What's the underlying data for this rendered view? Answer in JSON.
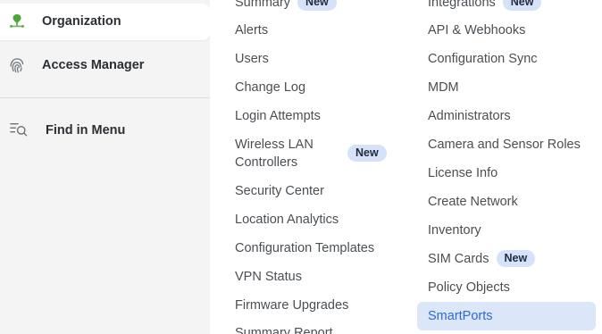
{
  "sidebar": {
    "organization_label": "Organization",
    "access_manager_label": "Access Manager",
    "find_in_menu_label": "Find in Menu"
  },
  "menu": {
    "new_badge": "New",
    "left": [
      {
        "label": "Summary",
        "badge": "New"
      },
      {
        "label": "Alerts"
      },
      {
        "label": "Users"
      },
      {
        "label": "Change Log"
      },
      {
        "label": "Login Attempts"
      },
      {
        "label_line1": "Wireless LAN",
        "label_line2": "Controllers",
        "badge": "New"
      },
      {
        "label": "Security Center"
      },
      {
        "label": "Location Analytics"
      },
      {
        "label": "Configuration Templates"
      },
      {
        "label": "VPN Status"
      },
      {
        "label": "Firmware Upgrades"
      },
      {
        "label": "Summary Report"
      }
    ],
    "right": [
      {
        "label": "Integrations",
        "badge": "New"
      },
      {
        "label": "API & Webhooks"
      },
      {
        "label": "Configuration Sync"
      },
      {
        "label": "MDM"
      },
      {
        "label": "Administrators"
      },
      {
        "label": "Camera and Sensor Roles"
      },
      {
        "label": "License Info"
      },
      {
        "label": "Create Network"
      },
      {
        "label": "Inventory"
      },
      {
        "label": "SIM Cards",
        "badge": "New"
      },
      {
        "label": "Policy Objects"
      },
      {
        "label": "SmartPorts",
        "selected": true
      }
    ]
  },
  "colors": {
    "accent": "#2f6ad0",
    "badge_bg": "#d6e2f7",
    "selected_bg": "#dbe6f8",
    "org_icon_green": "#4aa83a"
  }
}
